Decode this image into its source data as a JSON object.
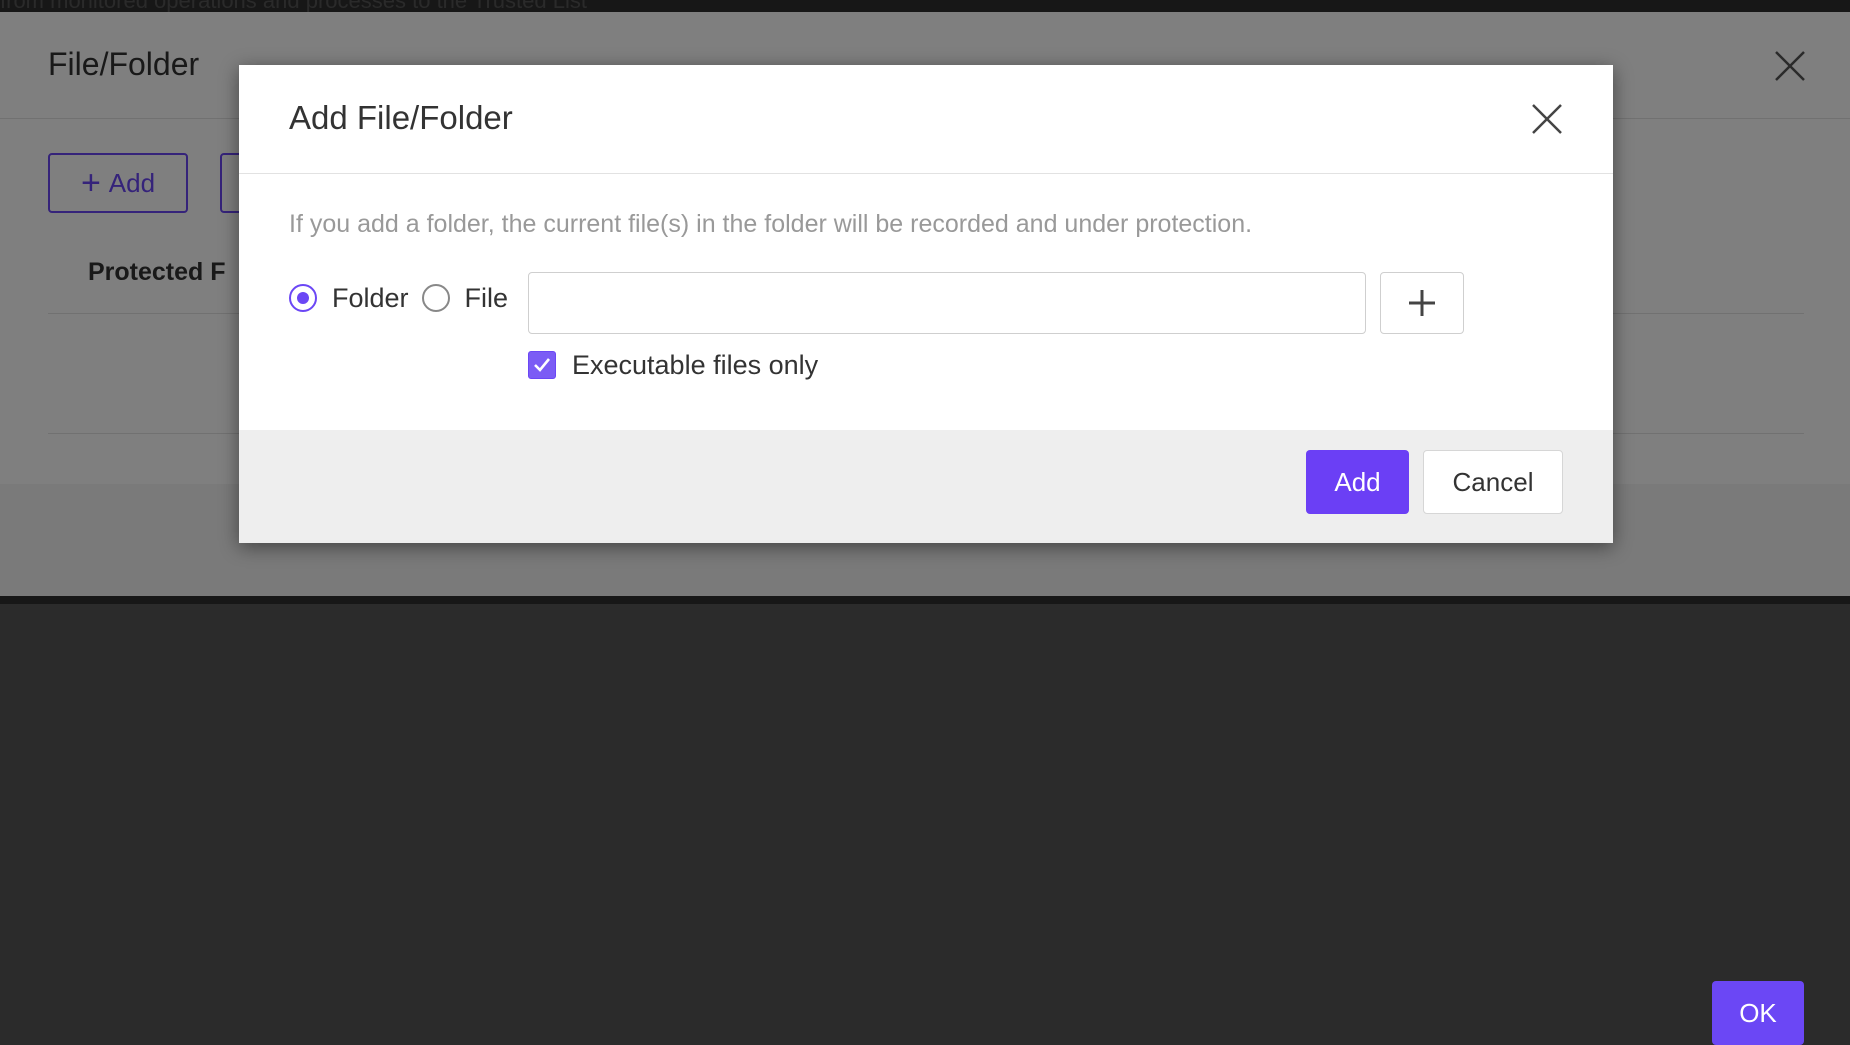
{
  "background": {
    "top_text": "from monitored operations and processes to the Trusted List",
    "title": "File/Folder",
    "add_button_label": "Add",
    "column_header": "Protected F",
    "ok_button_label": "OK"
  },
  "modal": {
    "title": "Add File/Folder",
    "hint": "If you add a folder, the current file(s) in the folder will be recorded and under protection.",
    "radio_folder_label": "Folder",
    "radio_file_label": "File",
    "selected_type": "Folder",
    "path_value": "",
    "executable_only_label": "Executable files only",
    "executable_only_checked": true,
    "add_button_label": "Add",
    "cancel_button_label": "Cancel"
  },
  "colors": {
    "accent": "#6b47f5",
    "overlay": "rgba(0,0,0,0.5)"
  },
  "icons": [
    "close-icon",
    "plus-icon",
    "checkmark-icon",
    "radio-selected-icon",
    "radio-unselected-icon"
  ]
}
